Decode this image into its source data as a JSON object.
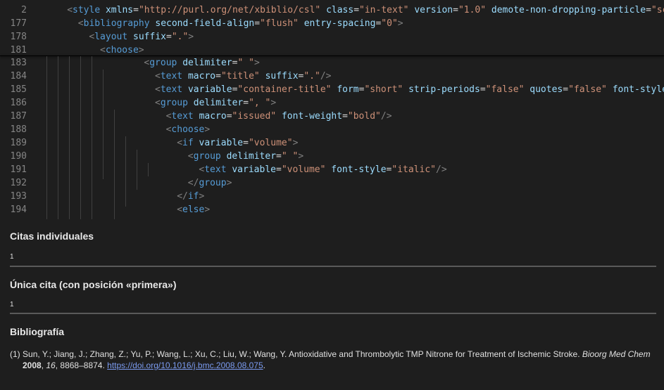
{
  "editor": {
    "lines": [
      {
        "num": "2",
        "indent": 4,
        "tokens": [
          [
            "punc",
            "<"
          ],
          [
            "tag",
            "style"
          ],
          [
            "sp",
            " "
          ],
          [
            "attr",
            "xmlns"
          ],
          [
            "eq",
            "="
          ],
          [
            "str",
            "\"http://purl.org/net/xbiblio/csl\""
          ],
          [
            "sp",
            " "
          ],
          [
            "attr",
            "class"
          ],
          [
            "eq",
            "="
          ],
          [
            "str",
            "\"in-text\""
          ],
          [
            "sp",
            " "
          ],
          [
            "attr",
            "version"
          ],
          [
            "eq",
            "="
          ],
          [
            "str",
            "\"1.0\""
          ],
          [
            "sp",
            " "
          ],
          [
            "attr",
            "demote-non-dropping-particle"
          ],
          [
            "eq",
            "="
          ],
          [
            "str",
            "\"sc"
          ]
        ]
      },
      {
        "num": "177",
        "indent": 6,
        "tokens": [
          [
            "punc",
            "<"
          ],
          [
            "tag",
            "bibliography"
          ],
          [
            "sp",
            " "
          ],
          [
            "attr",
            "second-field-align"
          ],
          [
            "eq",
            "="
          ],
          [
            "str",
            "\"flush\""
          ],
          [
            "sp",
            " "
          ],
          [
            "attr",
            "entry-spacing"
          ],
          [
            "eq",
            "="
          ],
          [
            "str",
            "\"0\""
          ],
          [
            "punc",
            ">"
          ]
        ]
      },
      {
        "num": "178",
        "indent": 8,
        "tokens": [
          [
            "punc",
            "<"
          ],
          [
            "tag",
            "layout"
          ],
          [
            "sp",
            " "
          ],
          [
            "attr",
            "suffix"
          ],
          [
            "eq",
            "="
          ],
          [
            "str",
            "\".\""
          ],
          [
            "punc",
            ">"
          ]
        ]
      },
      {
        "num": "181",
        "indent": 10,
        "tokens": [
          [
            "punc",
            "<"
          ],
          [
            "tag",
            "choose"
          ],
          [
            "punc",
            ">"
          ]
        ]
      },
      {
        "num": "183",
        "indent": 18,
        "tokens": [
          [
            "punc",
            "<"
          ],
          [
            "tag",
            "group"
          ],
          [
            "sp",
            " "
          ],
          [
            "attr",
            "delimiter"
          ],
          [
            "eq",
            "="
          ],
          [
            "str",
            "\" \""
          ],
          [
            "punc",
            ">"
          ]
        ]
      },
      {
        "num": "184",
        "indent": 20,
        "tokens": [
          [
            "punc",
            "<"
          ],
          [
            "tag",
            "text"
          ],
          [
            "sp",
            " "
          ],
          [
            "attr",
            "macro"
          ],
          [
            "eq",
            "="
          ],
          [
            "str",
            "\"title\""
          ],
          [
            "sp",
            " "
          ],
          [
            "attr",
            "suffix"
          ],
          [
            "eq",
            "="
          ],
          [
            "str",
            "\".\""
          ],
          [
            "punc",
            "/>"
          ]
        ]
      },
      {
        "num": "185",
        "indent": 20,
        "tokens": [
          [
            "punc",
            "<"
          ],
          [
            "tag",
            "text"
          ],
          [
            "sp",
            " "
          ],
          [
            "attr",
            "variable"
          ],
          [
            "eq",
            "="
          ],
          [
            "str",
            "\"container-title\""
          ],
          [
            "sp",
            " "
          ],
          [
            "attr",
            "form"
          ],
          [
            "eq",
            "="
          ],
          [
            "str",
            "\"short\""
          ],
          [
            "sp",
            " "
          ],
          [
            "attr",
            "strip-periods"
          ],
          [
            "eq",
            "="
          ],
          [
            "str",
            "\"false\""
          ],
          [
            "sp",
            " "
          ],
          [
            "attr",
            "quotes"
          ],
          [
            "eq",
            "="
          ],
          [
            "str",
            "\"false\""
          ],
          [
            "sp",
            " "
          ],
          [
            "attr",
            "font-style"
          ],
          [
            "eq",
            "="
          ],
          [
            "str",
            "\"ita"
          ]
        ]
      },
      {
        "num": "186",
        "indent": 20,
        "tokens": [
          [
            "punc",
            "<"
          ],
          [
            "tag",
            "group"
          ],
          [
            "sp",
            " "
          ],
          [
            "attr",
            "delimiter"
          ],
          [
            "eq",
            "="
          ],
          [
            "str",
            "\", \""
          ],
          [
            "punc",
            ">"
          ]
        ]
      },
      {
        "num": "187",
        "indent": 22,
        "tokens": [
          [
            "punc",
            "<"
          ],
          [
            "tag",
            "text"
          ],
          [
            "sp",
            " "
          ],
          [
            "attr",
            "macro"
          ],
          [
            "eq",
            "="
          ],
          [
            "str",
            "\"issued\""
          ],
          [
            "sp",
            " "
          ],
          [
            "attr",
            "font-weight"
          ],
          [
            "eq",
            "="
          ],
          [
            "str",
            "\"bold\""
          ],
          [
            "punc",
            "/>"
          ]
        ]
      },
      {
        "num": "188",
        "indent": 22,
        "tokens": [
          [
            "punc",
            "<"
          ],
          [
            "tag",
            "choose"
          ],
          [
            "punc",
            ">"
          ]
        ]
      },
      {
        "num": "189",
        "indent": 24,
        "tokens": [
          [
            "punc",
            "<"
          ],
          [
            "tag",
            "if"
          ],
          [
            "sp",
            " "
          ],
          [
            "attr",
            "variable"
          ],
          [
            "eq",
            "="
          ],
          [
            "str",
            "\"volume\""
          ],
          [
            "punc",
            ">"
          ]
        ]
      },
      {
        "num": "190",
        "indent": 26,
        "tokens": [
          [
            "punc",
            "<"
          ],
          [
            "tag",
            "group"
          ],
          [
            "sp",
            " "
          ],
          [
            "attr",
            "delimiter"
          ],
          [
            "eq",
            "="
          ],
          [
            "str",
            "\" \""
          ],
          [
            "punc",
            ">"
          ]
        ]
      },
      {
        "num": "191",
        "indent": 28,
        "tokens": [
          [
            "punc",
            "<"
          ],
          [
            "tag",
            "text"
          ],
          [
            "sp",
            " "
          ],
          [
            "attr",
            "variable"
          ],
          [
            "eq",
            "="
          ],
          [
            "str",
            "\"volume\""
          ],
          [
            "sp",
            " "
          ],
          [
            "attr",
            "font-style"
          ],
          [
            "eq",
            "="
          ],
          [
            "str",
            "\"italic\""
          ],
          [
            "punc",
            "/>"
          ]
        ]
      },
      {
        "num": "192",
        "indent": 26,
        "tokens": [
          [
            "punc",
            "</"
          ],
          [
            "tag",
            "group"
          ],
          [
            "punc",
            ">"
          ]
        ]
      },
      {
        "num": "193",
        "indent": 24,
        "tokens": [
          [
            "punc",
            "</"
          ],
          [
            "tag",
            "if"
          ],
          [
            "punc",
            ">"
          ]
        ]
      },
      {
        "num": "194",
        "indent": 24,
        "tokens": [
          [
            "punc",
            "<"
          ],
          [
            "tag",
            "else"
          ],
          [
            "punc",
            ">"
          ]
        ]
      }
    ]
  },
  "preview": {
    "individual": {
      "title": "Citas individuales",
      "value": "1"
    },
    "single": {
      "title": "Única cita (con posición «primera»)",
      "value": "1"
    },
    "bibliography": {
      "title": "Bibliografía",
      "entry": {
        "number": "(1)",
        "authors": "Sun, Y.; Jiang, J.; Zhang, Z.; Yu, P.; Wang, L.; Xu, C.; Liu, W.; Wang, Y.",
        "article_title": "Antioxidative and Thrombolytic TMP Nitrone for Treatment of Ischemic Stroke.",
        "journal": "Bioorg Med Chem",
        "year": "2008",
        "volume": "16",
        "pages": "8868–8874.",
        "doi": "https://doi.org/10.1016/j.bmc.2008.08.075"
      }
    }
  },
  "colors": {
    "background": "#1e1e1e",
    "tag": "#569cd6",
    "attribute": "#9cdcfe",
    "string": "#ce9178",
    "punctuation": "#808080",
    "line_number": "#858585",
    "link": "#7b9bf0"
  }
}
